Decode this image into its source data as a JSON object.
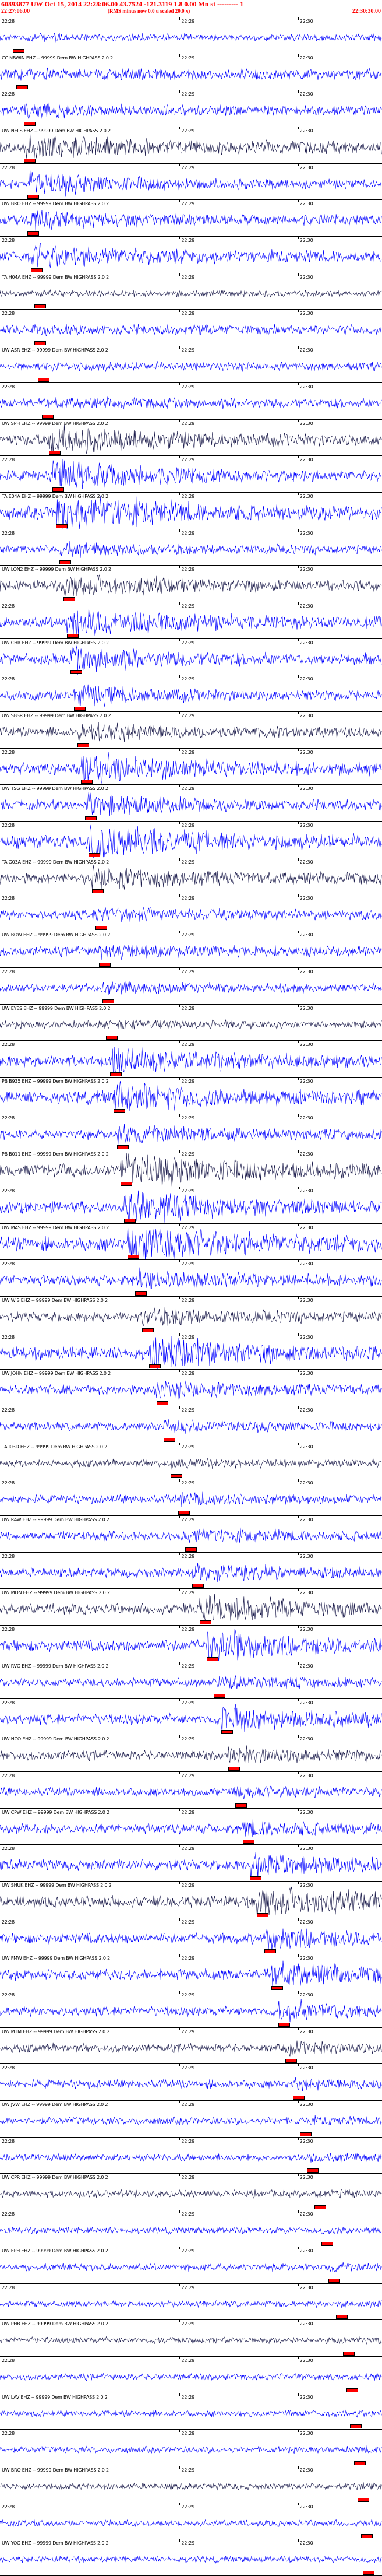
{
  "header": {
    "title": "60893877 UW Oct 15, 2014 22:28:06.00 43.7524 -121.3119 1.8 0.00 Mn st --------- 1",
    "start_time": "22:27:06.00",
    "scale_note": "(RMS minus now 0.0 u scaled 20.0 x)",
    "end_time": "22:30:30.00"
  },
  "time_labels": [
    "22:28",
    "22:29",
    "22:30"
  ],
  "colors": {
    "trace_primary": "#0000ff",
    "trace_dark": "#1a1a4a",
    "trace_black": "#000000",
    "pick": "#ff0000",
    "title": "#ff0000"
  },
  "channels": [
    {
      "label": "UW TWR1 EHZ -- 99999 Dem BW HIGHPASS 2.0 2",
      "amp": 0.35,
      "burst": 0.05,
      "pick": 0.02
    },
    {
      "label": "CC NBWIN EHZ -- 99999 Dem BW HIGHPASS 2.0 2",
      "amp": 0.5,
      "burst": 0.06,
      "pick": 0.03
    },
    {
      "label": "UW DONM EHZ -- 99999 Dem BW HIGHPASS 2.0 2",
      "amp": 0.45,
      "burst": 0.3,
      "pick": 0.05
    },
    {
      "label": "UW NELS EHZ -- 99999 Dem BW HIGHPASS 2.0 2",
      "amp": 0.55,
      "burst": 0.5,
      "pick": 0.05
    },
    {
      "label": "CC NEWG EHZ -- 99999 Dem BW HIGHPASS 2.0 2",
      "amp": 0.4,
      "burst": 0.8,
      "pick": 0.06
    },
    {
      "label": "UW BRO EHZ -- 99999 Dem BW HIGHPASS 2.0 2",
      "amp": 0.5,
      "burst": 0.3,
      "pick": 0.06
    },
    {
      "label": "UW SHW EHZ -- 99999 Dem BW HIGHPASS 2.0 2",
      "amp": 0.55,
      "burst": 0.5,
      "pick": 0.07
    },
    {
      "label": "TA H04A EHZ -- 99999 Dem BW HIGHPASS 2.0 2",
      "amp": 0.3,
      "burst": 0.05,
      "pick": 0.08
    },
    {
      "label": "UW EDM EHZ -- 99999 Dem BW HIGHPASS 2.0 2",
      "amp": 0.45,
      "burst": 0.1,
      "pick": 0.08
    },
    {
      "label": "UW ASR EHZ -- 99999 Dem BW HIGHPASS 2.0 2",
      "amp": 0.4,
      "burst": 0.1,
      "pick": 0.09
    },
    {
      "label": "UW ASR2 EHZ -- 99999 Dem BW HIGHPASS 2.0 2",
      "amp": 0.45,
      "burst": 0.1,
      "pick": 0.1
    },
    {
      "label": "UW SPH EHZ -- 99999 Dem BW HIGHPASS 2.0 2",
      "amp": 0.55,
      "burst": 0.6,
      "pick": 0.12
    },
    {
      "label": "PB B933 EHZ -- 99999 Dem BW HIGHPASS 2.0 2",
      "amp": 0.5,
      "burst": 0.8,
      "pick": 0.13
    },
    {
      "label": "TA E04A EHZ -- 99999 Dem BW HIGHPASS 2.0 2",
      "amp": 0.6,
      "burst": 0.9,
      "pick": 0.14
    },
    {
      "label": "UW JUNE EHZ -- 99999 Dem BW HIGHPASS 2.0 2",
      "amp": 0.4,
      "burst": 0.3,
      "pick": 0.15
    },
    {
      "label": "UW LON2 EHZ -- 99999 Dem BW HIGHPASS 2.0 2",
      "amp": 0.5,
      "burst": 0.5,
      "pick": 0.16
    },
    {
      "label": "UW BPO EHZ -- 99999 Dem BW HIGHPASS 2.0 2",
      "amp": 0.55,
      "burst": 0.7,
      "pick": 0.17
    },
    {
      "label": "UW CHR EHZ -- 99999 Dem BW HIGHPASS 2.0 2",
      "amp": 0.5,
      "burst": 0.6,
      "pick": 0.18
    },
    {
      "label": "UW DOH EHZ -- 99999 Dem BW HIGHPASS 2.0 2",
      "amp": 0.45,
      "burst": 0.5,
      "pick": 0.19
    },
    {
      "label": "UW SBSR EHZ -- 99999 Dem BW HIGHPASS 2.0 2",
      "amp": 0.45,
      "burst": 0.5,
      "pick": 0.2
    },
    {
      "label": "UW HOOD EHZ -- 99999 Dem BW HIGHPASS 2.0 2",
      "amp": 0.55,
      "burst": 0.7,
      "pick": 0.21
    },
    {
      "label": "UW TSG EHZ -- 99999 Dem BW HIGHPASS 2.0 2",
      "amp": 0.45,
      "burst": 0.6,
      "pick": 0.22
    },
    {
      "label": "UW OPW EHZ -- 99999 Dem BW HIGHPASS 2.0 2",
      "amp": 0.6,
      "burst": 0.8,
      "pick": 0.23
    },
    {
      "label": "TA G03A EHZ -- 99999 Dem BW HIGHPASS 2.0 2",
      "amp": 0.5,
      "burst": 0.5,
      "pick": 0.24
    },
    {
      "label": "UW HTW EHZ -- 99999 Dem BW HIGHPASS 2.0 2",
      "amp": 0.45,
      "burst": 0.3,
      "pick": 0.25
    },
    {
      "label": "UW BOW EHZ -- 99999 Dem BW HIGHPASS 2.0 2",
      "amp": 0.45,
      "burst": 0.3,
      "pick": 0.26
    },
    {
      "label": "CC STD EHZ -- 99999 Dem BW HIGHPASS 2.0 2",
      "amp": 0.4,
      "burst": 0.3,
      "pick": 0.27
    },
    {
      "label": "UW EYES EHZ -- 99999 Dem BW HIGHPASS 2.0 2",
      "amp": 0.35,
      "burst": 0.2,
      "pick": 0.28
    },
    {
      "label": "UW CTB EHZ -- 99999 Dem BW HIGHPASS 2.0 2",
      "amp": 0.55,
      "burst": 0.6,
      "pick": 0.29
    },
    {
      "label": "PB B935 EHZ -- 99999 Dem BW HIGHPASS 2.0 2",
      "amp": 0.6,
      "burst": 0.6,
      "pick": 0.3
    },
    {
      "label": "UW CTW EHZ -- 99999 Dem BW HIGHPASS 2.0 2",
      "amp": 0.45,
      "burst": 0.5,
      "pick": 0.31
    },
    {
      "label": "PB B011 EHZ -- 99999 Dem BW HIGHPASS 2.0 2",
      "amp": 0.6,
      "burst": 0.8,
      "pick": 0.32
    },
    {
      "label": "UW BOW EHZ -- 99999 Dem BW HIGHPASS 2.0 2",
      "amp": 0.55,
      "burst": 0.7,
      "pick": 0.33
    },
    {
      "label": "UW MAS EHZ -- 99999 Dem BW HIGHPASS 2.0 2",
      "amp": 0.65,
      "burst": 0.9,
      "pick": 0.34
    },
    {
      "label": "UW MWY EHZ -- 99999 Dem BW HIGHPASS 2.0 2",
      "amp": 0.5,
      "burst": 0.4,
      "pick": 0.36
    },
    {
      "label": "UW WIS EHZ -- 99999 Dem BW HIGHPASS 2.0 2",
      "amp": 0.45,
      "burst": 0.4,
      "pick": 0.38
    },
    {
      "label": "UW MCHN EHZ -- 99999 Dem BW HIGHPASS 2.0 2",
      "amp": 0.6,
      "burst": 0.7,
      "pick": 0.4
    },
    {
      "label": "UW JOHN EHZ -- 99999 Dem BW HIGHPASS 2.0 2",
      "amp": 0.45,
      "burst": 0.4,
      "pick": 0.42
    },
    {
      "label": "UW WAR EHZ -- 99999 Dem BW HIGHPASS 2.0 2",
      "amp": 0.4,
      "burst": 0.3,
      "pick": 0.44
    },
    {
      "label": "TA I03D EHZ -- 99999 Dem BW HIGHPASS 2.0 2",
      "amp": 0.35,
      "burst": 0.2,
      "pick": 0.46
    },
    {
      "label": "UW MPS EHZ -- 99999 Dem BW HIGHPASS 2.0 2",
      "amp": 0.4,
      "burst": 0.3,
      "pick": 0.48
    },
    {
      "label": "UW RAW EHZ -- 99999 Dem BW HIGHPASS 2.0 2",
      "amp": 0.45,
      "burst": 0.3,
      "pick": 0.5
    },
    {
      "label": "UW GRI EHZ -- 99999 Dem BW HIGHPASS 2.0 2",
      "amp": 0.45,
      "burst": 0.4,
      "pick": 0.52
    },
    {
      "label": "UW MON EHZ -- 99999 Dem BW HIGHPASS 2.0 2",
      "amp": 0.5,
      "burst": 0.7,
      "pick": 0.54
    },
    {
      "label": "UW PER EHZ -- 99999 Dem BW HIGHPASS 2.0 2",
      "amp": 0.55,
      "burst": 0.8,
      "pick": 0.56
    },
    {
      "label": "UW RVG EHZ -- 99999 Dem BW HIGHPASS 2.0 2",
      "amp": 0.4,
      "burst": 0.3,
      "pick": 0.58
    },
    {
      "label": "UW OSM EHZ -- 99999 Dem BW HIGHPASS 2.0 2",
      "amp": 0.5,
      "burst": 0.6,
      "pick": 0.6
    },
    {
      "label": "UW NCO EHZ -- 99999 Dem BW HIGHPASS 2.0 2",
      "amp": 0.45,
      "burst": 0.4,
      "pick": 0.62
    },
    {
      "label": "CC NORM EHZ -- 99999 Dem BW HIGHPASS 2.0 2",
      "amp": 0.4,
      "burst": 0.3,
      "pick": 0.64
    },
    {
      "label": "UW CPW EHZ -- 99999 Dem BW HIGHPASS 2.0 2",
      "amp": 0.45,
      "burst": 0.4,
      "pick": 0.66
    },
    {
      "label": "BR CHMT EHZ -- 99999 Dem BW HIGHPASS 2.0 2",
      "amp": 0.5,
      "burst": 0.5,
      "pick": 0.68
    },
    {
      "label": "UW SHUK EHZ -- 99999 Dem BW HIGHPASS 2.0 2",
      "amp": 0.55,
      "burst": 0.7,
      "pick": 0.7
    },
    {
      "label": "UW TWRH EHZ -- 99999 Dem BW HIGHPASS 2.0 2",
      "amp": 0.5,
      "burst": 0.6,
      "pick": 0.72
    },
    {
      "label": "UW FMW EHZ -- 99999 Dem BW HIGHPASS 2.0 2",
      "amp": 0.5,
      "burst": 0.6,
      "pick": 0.74
    },
    {
      "label": "UW LMRG EHZ -- 99999 Dem BW HIGHPASS 2.0 2",
      "amp": 0.45,
      "burst": 0.5,
      "pick": 0.76
    },
    {
      "label": "UW MTM EHZ -- 99999 Dem BW HIGHPASS 2.0 2",
      "amp": 0.4,
      "burst": 0.3,
      "pick": 0.78
    },
    {
      "label": "UW STOR EHZ -- 99999 Dem BW HIGHPASS 2.0 2",
      "amp": 0.4,
      "burst": 0.2,
      "pick": 0.8
    },
    {
      "label": "UW JVW EHZ -- 99999 Dem BW HIGHPASS 2.0 2",
      "amp": 0.35,
      "burst": 0.1,
      "pick": 0.82
    },
    {
      "label": "UW GSM EHZ -- 99999 Dem BW HIGHPASS 2.0 2",
      "amp": 0.35,
      "burst": 0.1,
      "pick": 0.84
    },
    {
      "label": "UW CPR EHZ -- 99999 Dem BW HIGHPASS 2.0 2",
      "amp": 0.35,
      "burst": 0.1,
      "pick": 0.86
    },
    {
      "label": "UW DORF EHZ -- 99999 Dem BW HIGHPASS 2.0 2",
      "amp": 0.3,
      "burst": 0.1,
      "pick": 0.88
    },
    {
      "label": "UW EPH EHZ -- 99999 Dem BW HIGHPASS 2.0 2",
      "amp": 0.35,
      "burst": 0.1,
      "pick": 0.9
    },
    {
      "label": "UW TSIH EHZ -- 99999 Dem BW HIGHPASS 2.0 2",
      "amp": 0.3,
      "burst": 0.1,
      "pick": 0.92
    },
    {
      "label": "UW PHB EHZ -- 99999 Dem BW HIGHPASS 2.0 2",
      "amp": 0.3,
      "burst": 0.1,
      "pick": 0.94
    },
    {
      "label": "UW KBO EHZ -- 99999 Dem BW HIGHPASS 2.0 2",
      "amp": 0.3,
      "burst": 0.1,
      "pick": 0.95
    },
    {
      "label": "UW LAV EHZ -- 99999 Dem BW HIGHPASS 2.0 2",
      "amp": 0.3,
      "burst": 0.1,
      "pick": 0.96
    },
    {
      "label": "UW BATE EHZ -- 99999 Dem BW HIGHPASS 2.0 2",
      "amp": 0.3,
      "burst": 0.1,
      "pick": 0.97
    },
    {
      "label": "UW BRO EHZ -- 99999 Dem BW HIGHPASS 2.0 2",
      "amp": 0.3,
      "burst": 0.1,
      "pick": 0.98
    },
    {
      "label": "UW TAH EHZ -- 99999 Dem BW HIGHPASS 2.0 2",
      "amp": 0.3,
      "burst": 0.1,
      "pick": 0.99
    },
    {
      "label": "UW YOG EHZ -- 99999 Dem BW HIGHPASS 2.0 2",
      "amp": 0.3,
      "burst": 0.1,
      "pick": 0.995
    }
  ]
}
